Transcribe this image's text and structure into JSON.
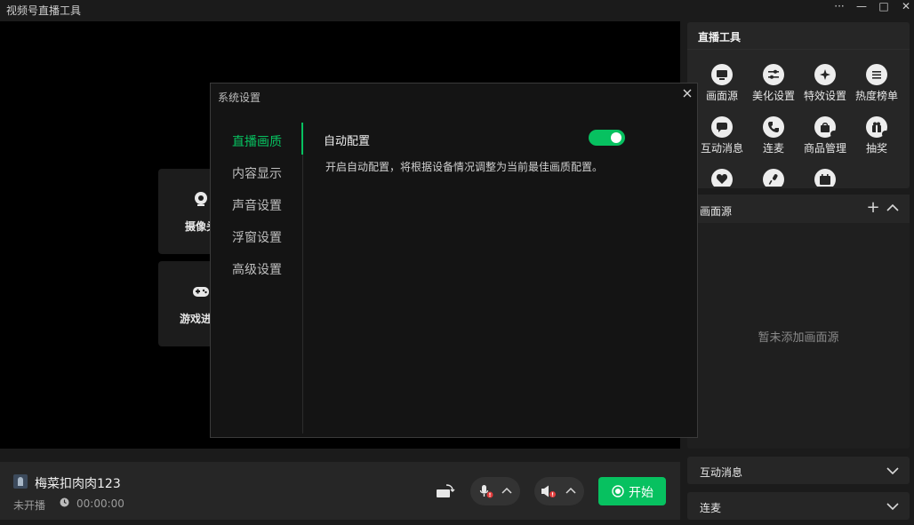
{
  "app": {
    "title": "视频号直播工具"
  },
  "window_controls": {
    "more": "···",
    "minimize": "—",
    "maximize": "□",
    "close": "✕"
  },
  "preview": {
    "camera_label": "摄像头",
    "game_label": "游戏进"
  },
  "tools": {
    "title": "直播工具",
    "items": [
      {
        "label": "画面源",
        "icon": "screen-icon"
      },
      {
        "label": "美化设置",
        "icon": "sliders-icon"
      },
      {
        "label": "特效设置",
        "icon": "sparkle-icon"
      },
      {
        "label": "热度榜单",
        "icon": "list-icon"
      },
      {
        "label": "互动消息",
        "icon": "chat-icon"
      },
      {
        "label": "连麦",
        "icon": "phone-icon"
      },
      {
        "label": "商品管理",
        "icon": "bag-icon"
      },
      {
        "label": "抽奖",
        "icon": "gift-icon"
      },
      {
        "label": "",
        "icon": "heart-icon"
      },
      {
        "label": "",
        "icon": "mic-icon"
      },
      {
        "label": "",
        "icon": "calendar-icon"
      }
    ]
  },
  "scenes": {
    "title": "画面源",
    "empty_text": "暂未添加画面源",
    "add_symbol": "+"
  },
  "interaction_panel": {
    "title": "互动消息"
  },
  "link_panel": {
    "title": "连麦"
  },
  "bottom": {
    "username": "梅菜扣肉肉123",
    "status": "未开播",
    "timer": "00:00:00",
    "start_label": "开始"
  },
  "colors": {
    "accent": "#07c160",
    "alert": "#e23b3b"
  },
  "settings_dialog": {
    "title": "系统设置",
    "nav": [
      "直播画质",
      "内容显示",
      "声音设置",
      "浮窗设置",
      "高级设置"
    ],
    "active_nav": "直播画质",
    "auto_config": {
      "label": "自动配置",
      "enabled": true,
      "description": "开启自动配置，将根据设备情况调整为当前最佳画质配置。"
    }
  }
}
